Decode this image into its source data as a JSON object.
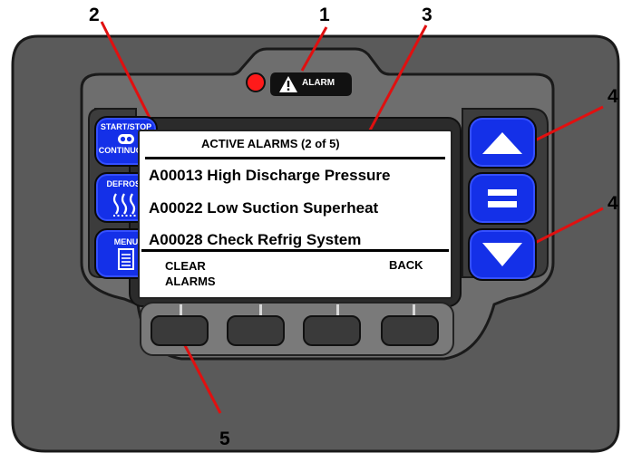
{
  "callouts": [
    "1",
    "2",
    "3",
    "4",
    "4",
    "5"
  ],
  "alarm_indicator": {
    "label": "ALARM",
    "led_color": "#ff1a1a"
  },
  "left_buttons": {
    "start_stop": {
      "line1": "START/STOP",
      "line2": "CONTINUOUS",
      "icon": "start-stop-icon"
    },
    "defrost": {
      "label": "DEFROST",
      "icon": "defrost-icon"
    },
    "menu": {
      "label": "MENU",
      "icon": "menu-icon"
    }
  },
  "right_buttons": {
    "up": {
      "icon": "up-arrow-icon"
    },
    "enter": {
      "icon": "equals-icon"
    },
    "down": {
      "icon": "down-arrow-icon"
    }
  },
  "screen": {
    "title": "ACTIVE ALARMS (2 of 5)",
    "alarms": [
      {
        "code": "A00013",
        "text": "High Discharge Pressure"
      },
      {
        "code": "A00022",
        "text": "Low Suction Superheat"
      },
      {
        "code": "A00028",
        "text": "Check Refrig System"
      }
    ],
    "soft_labels": {
      "clear_line1": "CLEAR",
      "clear_line2": "ALARMS",
      "back": "BACK"
    }
  },
  "colors": {
    "button_blue": "#1430e8",
    "body_dark": "#4a4a4a",
    "callout_red": "#e01010"
  }
}
